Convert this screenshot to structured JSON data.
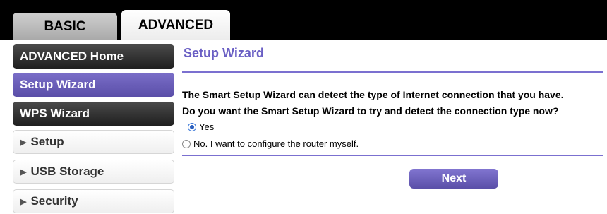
{
  "tabs": {
    "basic": "BASIC",
    "advanced": "ADVANCED"
  },
  "sidebar": {
    "items": [
      {
        "label": "ADVANCED Home",
        "state": "dark"
      },
      {
        "label": "Setup Wizard",
        "state": "active"
      },
      {
        "label": "WPS Wizard",
        "state": "dark"
      },
      {
        "label": "Setup",
        "state": "collapsed"
      },
      {
        "label": "USB Storage",
        "state": "collapsed"
      },
      {
        "label": "Security",
        "state": "collapsed"
      }
    ]
  },
  "main": {
    "title": "Setup Wizard",
    "question_line1": "The Smart Setup Wizard can detect the type of Internet connection that you have.",
    "question_line2": "Do you want the Smart Setup Wizard to try and detect the connection type now?",
    "options": [
      {
        "label": "Yes",
        "checked": true
      },
      {
        "label": "No. I want to configure the router myself.",
        "checked": false
      }
    ],
    "next_label": "Next"
  },
  "colors": {
    "accent": "#6a5fc4",
    "sidebar_dark": "#2b2b2b",
    "topbar": "#000000"
  }
}
